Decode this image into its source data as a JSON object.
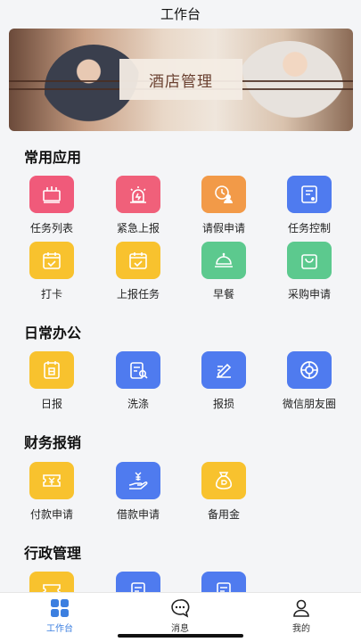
{
  "header": {
    "title": "工作台"
  },
  "banner": {
    "label": "酒店管理"
  },
  "sections": [
    {
      "title": "常用应用"
    },
    {
      "title": "日常办公"
    },
    {
      "title": "财务报销"
    },
    {
      "title": "行政管理"
    }
  ],
  "apps": [
    {
      "label": "任务列表",
      "color": "#f05a7a",
      "icon": "task-list-icon"
    },
    {
      "label": "紧急上报",
      "color": "#f0607a",
      "icon": "alarm-icon"
    },
    {
      "label": "请假申请",
      "color": "#f29a48",
      "icon": "leave-request-icon"
    },
    {
      "label": "任务控制",
      "color": "#4f7bef",
      "icon": "task-control-icon"
    },
    {
      "label": "打卡",
      "color": "#f8c22e",
      "icon": "calendar-check-icon"
    },
    {
      "label": "上报任务",
      "color": "#f8c22e",
      "icon": "calendar-check-icon"
    },
    {
      "label": "早餐",
      "color": "#5cc98e",
      "icon": "dining-cloche-icon"
    },
    {
      "label": "采购申请",
      "color": "#5cc98e",
      "icon": "shopping-bag-icon"
    }
  ],
  "office": [
    {
      "label": "日报",
      "color": "#f8c22e",
      "icon": "daily-report-icon"
    },
    {
      "label": "洗涤",
      "color": "#4f7bef",
      "icon": "laundry-search-icon"
    },
    {
      "label": "报损",
      "color": "#4f7bef",
      "icon": "edit-report-icon"
    },
    {
      "label": "微信朋友圈",
      "color": "#4f7bef",
      "icon": "moments-icon"
    }
  ],
  "finance": [
    {
      "label": "付款申请",
      "color": "#f8c22e",
      "icon": "payment-ticket-icon"
    },
    {
      "label": "借款申请",
      "color": "#4f7bef",
      "icon": "loan-hand-icon"
    },
    {
      "label": "备用金",
      "color": "#f8c22e",
      "icon": "money-bag-icon"
    }
  ],
  "admin": [
    {
      "color": "#f8c22e",
      "icon": "ticket-icon"
    },
    {
      "color": "#4f7bef",
      "icon": "document-icon"
    },
    {
      "color": "#4f7bef",
      "icon": "document-icon"
    }
  ],
  "tabbar": {
    "active_color": "#3c7fe0",
    "items": [
      {
        "label": "工作台",
        "icon": "grid-icon"
      },
      {
        "label": "消息",
        "icon": "chat-icon"
      },
      {
        "label": "我的",
        "icon": "user-icon"
      }
    ]
  }
}
